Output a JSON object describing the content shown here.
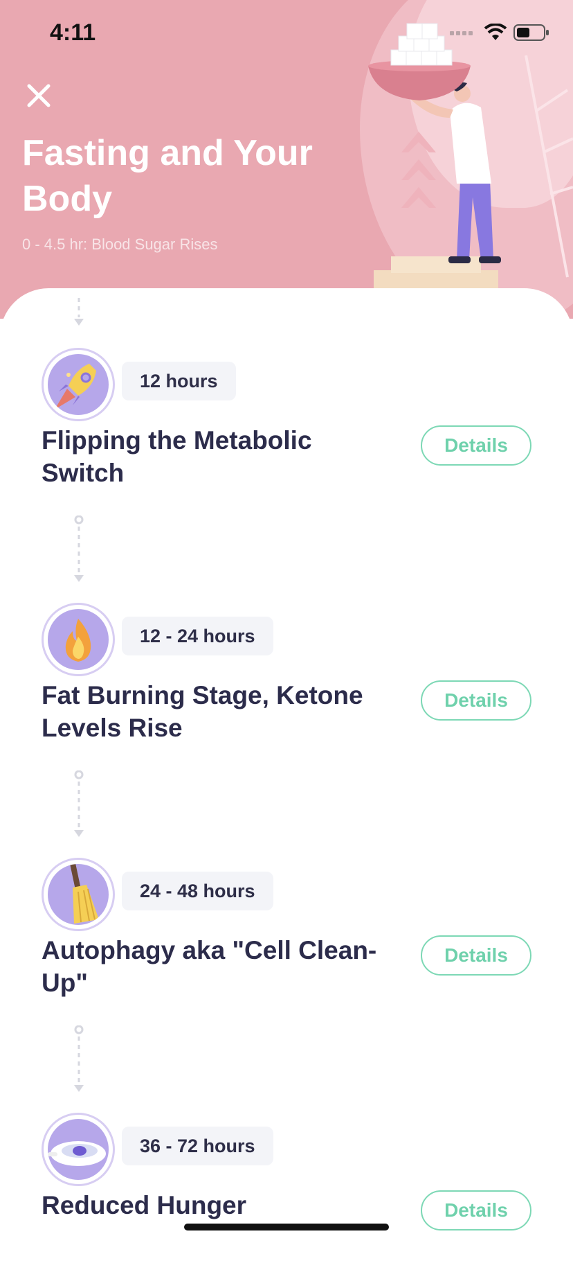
{
  "status_bar": {
    "time": "4:11"
  },
  "header": {
    "title": "Fasting and Your Body",
    "subtitle": "0 - 4.5 hr: Blood Sugar Rises",
    "background": "#e9a8b1"
  },
  "stages": [
    {
      "hours": "12 hours",
      "title": "Flipping the Metabolic Switch",
      "details_label": "Details",
      "icon": "rocket-icon"
    },
    {
      "hours": "12 - 24 hours",
      "title": "Fat Burning Stage, Ketone Levels Rise",
      "details_label": "Details",
      "icon": "flame-icon"
    },
    {
      "hours": "24 - 48 hours",
      "title": "Autophagy aka \"Cell Clean-Up\"",
      "details_label": "Details",
      "icon": "broom-icon"
    },
    {
      "hours": "36 - 72 hours",
      "title": "Reduced Hunger",
      "details_label": "Details",
      "icon": "bowl-icon"
    }
  ],
  "colors": {
    "accent": "#7dd8b5",
    "icon_bg": "#b6a7ea",
    "title_text": "#2c2c4b"
  }
}
